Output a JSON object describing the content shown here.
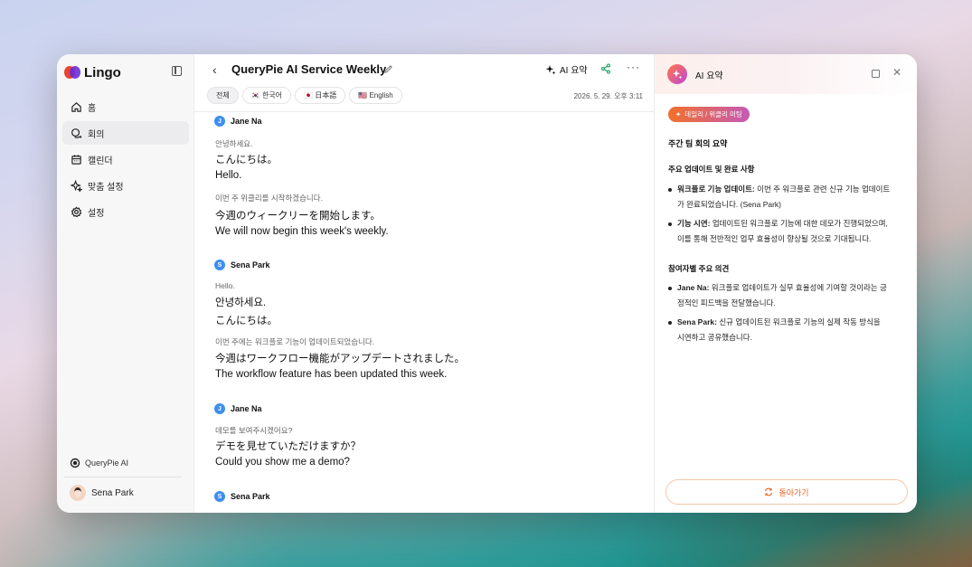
{
  "app": {
    "name": "Lingo"
  },
  "sidebar": {
    "items": [
      {
        "label": "홈",
        "icon": "home-icon"
      },
      {
        "label": "회의",
        "icon": "chat-icon"
      },
      {
        "label": "캘린더",
        "icon": "calendar-icon"
      },
      {
        "label": "맞춤 설정",
        "icon": "sparkle-icon"
      },
      {
        "label": "설정",
        "icon": "gear-icon"
      }
    ],
    "active_index": 1,
    "brand": "QueryPie AI",
    "user": "Sena Park"
  },
  "header": {
    "title": "QueryPie AI Service Weekly",
    "ai_summary_label": "AI 요약",
    "timestamp": "2026. 5. 29. 오후 3:11"
  },
  "lang_tabs": [
    {
      "label": "전체",
      "flag": ""
    },
    {
      "label": "한국어",
      "flag": "🇰🇷"
    },
    {
      "label": "日本語",
      "flag": "🇯🇵"
    },
    {
      "label": "English",
      "flag": "🇺🇸"
    }
  ],
  "transcript": [
    {
      "speaker": "Jane Na",
      "initial": "J",
      "lines": [
        {
          "type": "src",
          "text": "안녕하세요."
        },
        {
          "type": "main",
          "text": "こんにちは。"
        },
        {
          "type": "main",
          "text": "Hello."
        },
        {
          "type": "src",
          "text": "이번 주 위클리를 시작하겠습니다."
        },
        {
          "type": "main",
          "text": "今週のウィークリーを開始します。"
        },
        {
          "type": "main",
          "text": "We will now begin this week's weekly."
        }
      ]
    },
    {
      "speaker": "Sena Park",
      "initial": "S",
      "lines": [
        {
          "type": "src",
          "text": "Hello."
        },
        {
          "type": "main",
          "text": "안녕하세요."
        },
        {
          "type": "main",
          "text": "こんにちは。"
        },
        {
          "type": "src",
          "text": "이번 주에는 워크플로 기능이 업데이트되었습니다."
        },
        {
          "type": "main",
          "text": "今週はワークフロー機能がアップデートされました。"
        },
        {
          "type": "main",
          "text": "The workflow feature has been updated this week."
        }
      ]
    },
    {
      "speaker": "Jane Na",
      "initial": "J",
      "lines": [
        {
          "type": "src",
          "text": "데모를 보여주시겠어요?"
        },
        {
          "type": "main",
          "text": "デモを見せていただけますか？"
        },
        {
          "type": "main",
          "text": "Could you show me a demo?"
        }
      ]
    },
    {
      "speaker": "Sena Park",
      "initial": "S",
      "lines": []
    }
  ],
  "panel": {
    "title": "AI 요약",
    "tag": "데일리 / 위클리 미팅",
    "summary_title": "주간 팀 회의 요약",
    "section1_title": "주요 업데이트 및 완료 사항",
    "section1_bullets": [
      {
        "bold": "워크플로 기능 업데이트:",
        "line1": " 이번 주 워크플로 관련 신규 기능 업데이트",
        "line2": "가 완료되었습니다. (Sena Park)"
      },
      {
        "bold": "기능 시연:",
        "line1": " 업데이트된 워크플로 기능에 대한 데모가 진행되었으며,",
        "line2": "이를 통해 전반적인 업무 효율성이 향상될 것으로 기대됩니다."
      }
    ],
    "section2_title": "참여자별 주요 의견",
    "section2_bullets": [
      {
        "bold": "Jane Na:",
        "line1": " 워크플로 업데이트가 실무 효율성에 기여할 것이라는 긍",
        "line2": "정적인 피드백을 전달했습니다."
      },
      {
        "bold": "Sena Park:",
        "line1": " 신규 업데이트된 워크플로 기능의 실제 작동 방식을",
        "line2": "시연하고 공유했습니다."
      }
    ],
    "back_label": "돌아가기"
  },
  "colors": {
    "accent": "#e8641f",
    "speaker_badge": "#3d8ef0",
    "logo_red": "#e8452c",
    "logo_purple": "#6b2bd6"
  }
}
